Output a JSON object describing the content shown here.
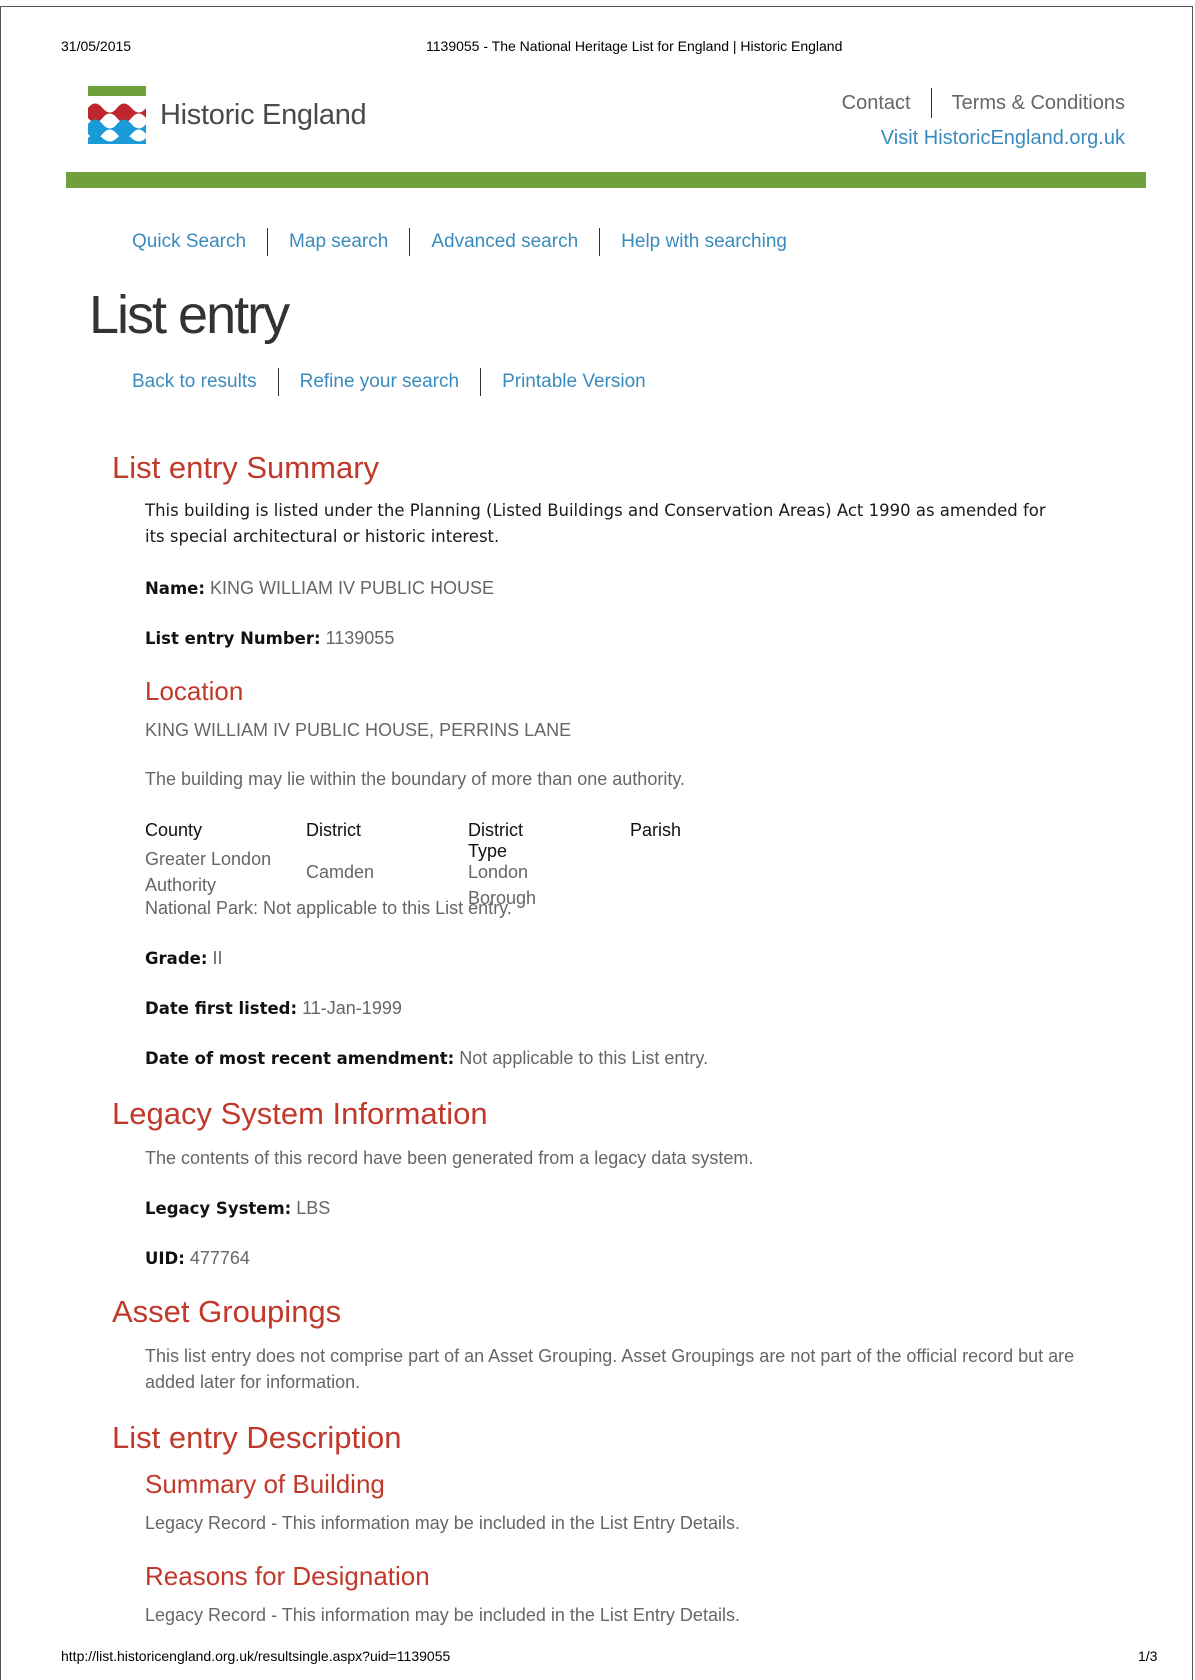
{
  "print": {
    "date": "31/05/2015",
    "title": "1139055 - The National Heritage List for England | Historic England",
    "url": "http://list.historicengland.org.uk/resultsingle.aspx?uid=1139055",
    "page": "1/3"
  },
  "brand": {
    "name": "Historic England",
    "accent": "#70a03c",
    "link": "#3a8bbd",
    "heading": "#c0392b"
  },
  "top_links": {
    "contact": "Contact",
    "terms": "Terms & Conditions",
    "visit": "Visit HistoricEngland.org.uk"
  },
  "search_nav": [
    "Quick Search",
    "Map search",
    "Advanced search",
    "Help with searching"
  ],
  "page_title": "List entry",
  "sub_nav": [
    "Back to results",
    "Refine your search",
    "Printable Version"
  ],
  "summary": {
    "heading": "List entry Summary",
    "intro": "This building is listed under the Planning (Listed Buildings and Conservation Areas) Act 1990 as amended for its special architectural or historic interest.",
    "name_label": "Name:",
    "name": "KING WILLIAM IV PUBLIC HOUSE",
    "number_label": "List entry Number:",
    "number": "1139055"
  },
  "location": {
    "heading": "Location",
    "address": "KING WILLIAM IV PUBLIC HOUSE, PERRINS LANE",
    "note": "The building may lie within the boundary of more than one authority.",
    "headers": [
      "County",
      "District",
      "District Type",
      "Parish"
    ],
    "row": [
      "Greater London Authority",
      "Camden",
      "London Borough",
      ""
    ],
    "national_park": "National Park: Not applicable to this List entry."
  },
  "grade": {
    "label": "Grade:",
    "value": "II"
  },
  "date_listed": {
    "label": "Date first listed:",
    "value": "11-Jan-1999"
  },
  "amendment": {
    "label": "Date of most recent amendment:",
    "value": "Not applicable to this List entry."
  },
  "legacy": {
    "heading": "Legacy System Information",
    "intro": "The contents of this record have been generated from a legacy data system.",
    "system_label": "Legacy System:",
    "system": "LBS",
    "uid_label": "UID:",
    "uid": "477764"
  },
  "asset": {
    "heading": "Asset Groupings",
    "text": "This list entry does not comprise part of an Asset Grouping. Asset Groupings are not part of the official record but are added later for information."
  },
  "description": {
    "heading": "List entry Description",
    "summary_heading": "Summary of Building",
    "summary_text": "Legacy Record - This information may be included in the List Entry Details.",
    "reasons_heading": "Reasons for Designation",
    "reasons_text": "Legacy Record - This information may be included in the List Entry Details."
  }
}
